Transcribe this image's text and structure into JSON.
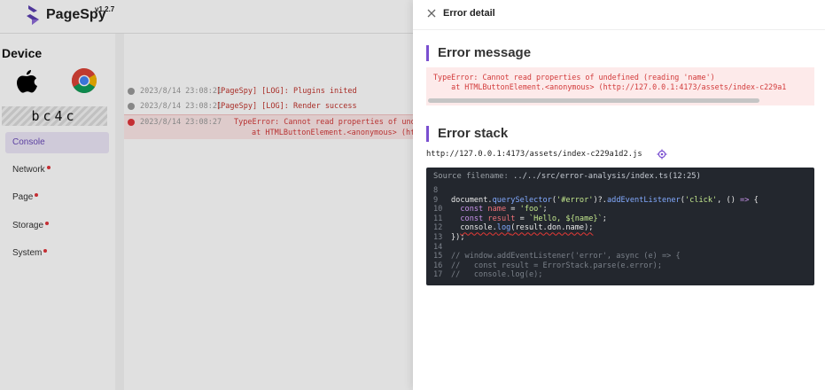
{
  "app": {
    "brand": "PageSpy",
    "version": "v1.2.7"
  },
  "sidebar": {
    "device_title": "Device",
    "os_icon": "apple-icon",
    "browser_icon": "chrome-icon",
    "device_id": "bc4c",
    "items": [
      {
        "label": "Console",
        "active": true,
        "dot": false
      },
      {
        "label": "Network",
        "active": false,
        "dot": true
      },
      {
        "label": "Page",
        "active": false,
        "dot": true
      },
      {
        "label": "Storage",
        "active": false,
        "dot": true
      },
      {
        "label": "System",
        "active": false,
        "dot": true
      }
    ]
  },
  "logs": [
    {
      "time": "2023/8/14 23:08:21",
      "message": "[PageSpy] [LOG]: Plugins inited",
      "type": "log"
    },
    {
      "time": "2023/8/14 23:08:21",
      "message": "[PageSpy] [LOG]: Render success",
      "type": "log"
    },
    {
      "time": "2023/8/14 23:08:27",
      "message": "TypeError: Cannot read properties of und",
      "message_line2": "at HTMLButtonElement.<anonymous> (ht",
      "type": "error"
    }
  ],
  "drawer": {
    "title": "Error detail",
    "close_icon": "close-icon",
    "error_message_title": "Error message",
    "error_message_line1": "TypeError: Cannot read properties of undefined (reading 'name')",
    "error_message_line2": "    at HTMLButtonElement.<anonymous> (http://127.0.0.1:4173/assets/index-c229a1",
    "error_stack_title": "Error stack",
    "stack_url": "http://127.0.0.1:4173/assets/index-c229a1d2.js",
    "locate_icon": "crosshair-icon",
    "source_label": "Source filename:",
    "source_filename": "../../src/error-analysis/index.ts(12:25)",
    "code_lines": [
      {
        "num": "8",
        "text": ""
      },
      {
        "num": "9",
        "text": "document.querySelector('#error')?.addEventListener('click', () => {"
      },
      {
        "num": "10",
        "text": "  const name = 'foo';"
      },
      {
        "num": "11",
        "text": "  const result = `Hello, ${name}`;"
      },
      {
        "num": "12",
        "text": "  console.log(result.don.name);"
      },
      {
        "num": "13",
        "text": "});"
      },
      {
        "num": "14",
        "text": ""
      },
      {
        "num": "15",
        "text": "// window.addEventListener('error', async (e) => {"
      },
      {
        "num": "16",
        "text": "//   const result = ErrorStack.parse(e.error);"
      },
      {
        "num": "17",
        "text": "//   console.log(e);"
      }
    ]
  },
  "colors": {
    "accent": "#7a4fd0",
    "error": "#d23a3a",
    "error_bg": "#fdeaea",
    "code_bg": "#23272e"
  }
}
